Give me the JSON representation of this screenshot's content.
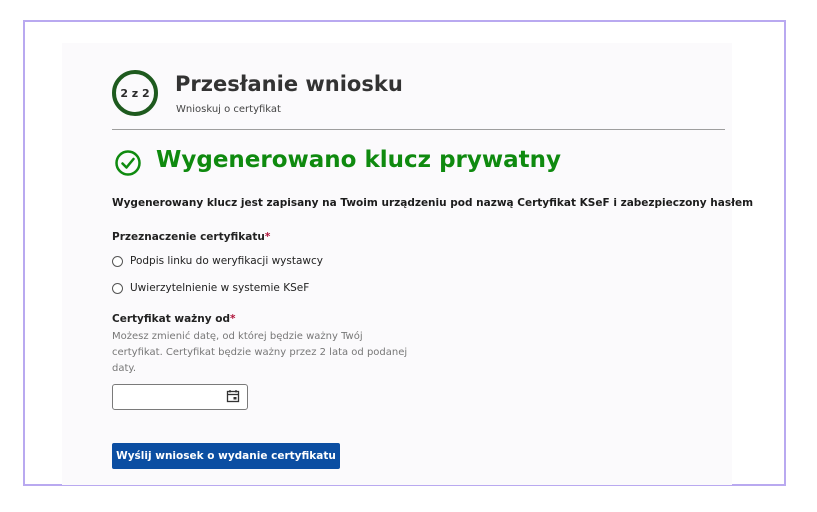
{
  "header": {
    "step_indicator": "2 z 2",
    "title": "Przesłanie wniosku",
    "subtitle": "Wnioskuj o certyfikat"
  },
  "success": {
    "heading": "Wygenerowano klucz prywatny",
    "info": "Wygenerowany klucz jest zapisany na Twoim urządzeniu pod nazwą Certyfikat KSeF i zabezpieczony hasłem"
  },
  "purpose": {
    "label": "Przeznaczenie certyfikatu",
    "required_mark": "*",
    "options": [
      "Podpis linku do weryfikacji wystawcy",
      "Uwierzytelnienie w systemie KSeF"
    ]
  },
  "valid_from": {
    "label": "Certyfikat ważny od",
    "required_mark": "*",
    "hint": "Możesz zmienić datę, od której będzie ważny Twój certyfikat. Certyfikat będzie ważny przez 2 lata od podanej daty.",
    "value": ""
  },
  "submit": {
    "label": "Wyślij wniosek o wydanie certyfikatu"
  },
  "colors": {
    "success_green": "#0f8a0f",
    "step_ring": "#1e5a1e",
    "primary_button": "#0b4ea2",
    "required": "#b0143a",
    "frame_border": "#b9a9f0"
  }
}
